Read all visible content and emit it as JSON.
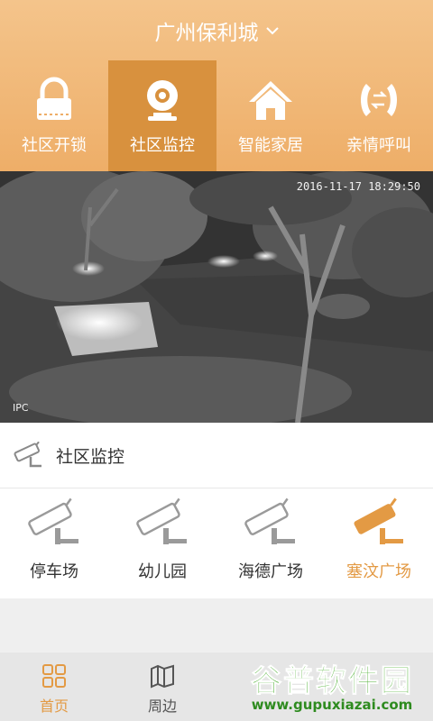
{
  "header": {
    "title": "广州保利城"
  },
  "quick_actions": [
    {
      "label": "社区开锁",
      "icon": "padlock-icon",
      "active": false
    },
    {
      "label": "社区监控",
      "icon": "webcam-icon",
      "active": true
    },
    {
      "label": "智能家居",
      "icon": "home-icon",
      "active": false
    },
    {
      "label": "亲情呼叫",
      "icon": "phone-transfer-icon",
      "active": false
    }
  ],
  "video": {
    "timestamp": "2016-11-17 18:29:50",
    "source_label": "IPC"
  },
  "section": {
    "title": "社区监控"
  },
  "cameras": [
    {
      "name": "停车场",
      "active": false
    },
    {
      "name": "幼儿园",
      "active": false
    },
    {
      "name": "海德广场",
      "active": false
    },
    {
      "name": "塞汶广场",
      "active": true
    }
  ],
  "tabbar": [
    {
      "label": "首页",
      "icon": "grid-icon",
      "active": true
    },
    {
      "label": "周边",
      "icon": "map-icon",
      "active": false
    },
    {
      "label": "",
      "icon": "",
      "active": false
    },
    {
      "label": "",
      "icon": "",
      "active": false
    }
  ],
  "watermark": {
    "text": "谷普软件园",
    "url": "www.gupuxiazai.com"
  },
  "colors": {
    "accent": "#e39a44",
    "header_top": "#f4c48b",
    "header_bottom": "#eeae68",
    "active_tile": "#d8913e"
  }
}
